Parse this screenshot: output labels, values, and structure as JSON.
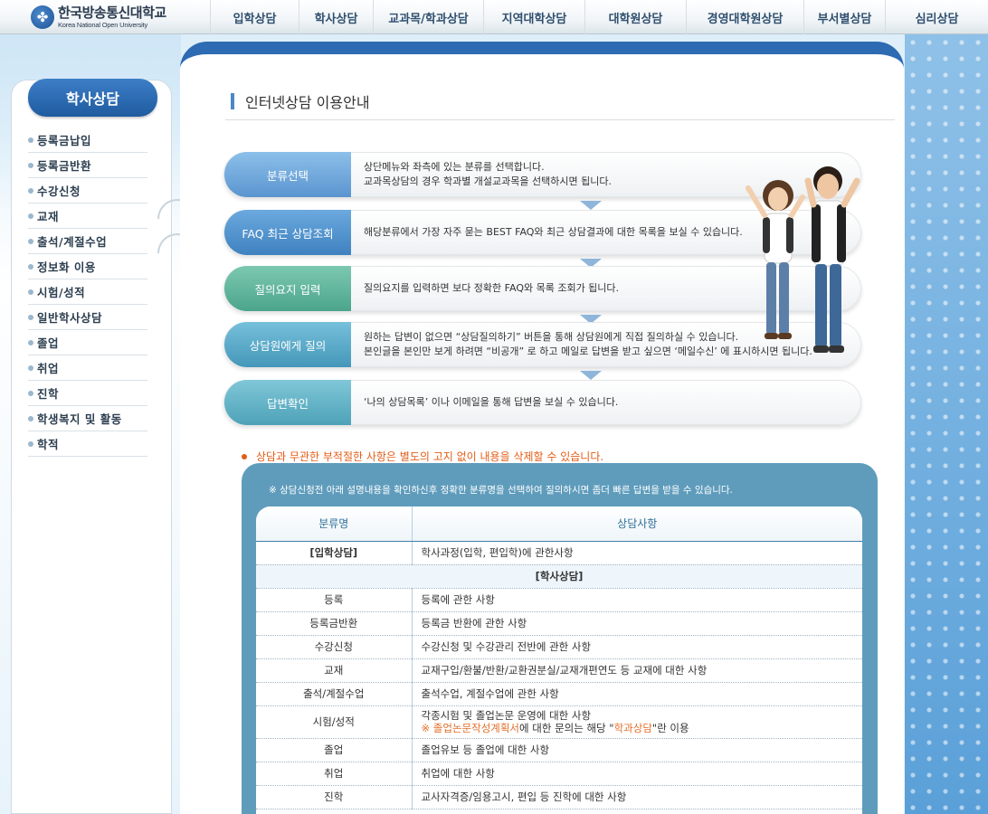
{
  "logo": {
    "mark": "✤",
    "name_ko": "한국방송통신대학교",
    "name_en": "Korea National Open University"
  },
  "nav": [
    {
      "label": "입학상담"
    },
    {
      "label": "학사상담"
    },
    {
      "label": "교과목/학과상담"
    },
    {
      "label": "지역대학상담"
    },
    {
      "label": "대학원상담"
    },
    {
      "label": "경영대학원상담"
    },
    {
      "label": "부서별상담"
    },
    {
      "label": "심리상담"
    }
  ],
  "sidebar": {
    "title": "학사상담",
    "items": [
      {
        "label": "등록금납입"
      },
      {
        "label": "등록금반환"
      },
      {
        "label": "수강신청"
      },
      {
        "label": "교재"
      },
      {
        "label": "출석/계절수업"
      },
      {
        "label": "정보화 이용"
      },
      {
        "label": "시험/성적"
      },
      {
        "label": "일반학사상담"
      },
      {
        "label": "졸업"
      },
      {
        "label": "취업"
      },
      {
        "label": "진학"
      },
      {
        "label": "학생복지 및 활동"
      },
      {
        "label": "학적"
      }
    ]
  },
  "main": {
    "title": "인터넷상담 이용안내",
    "steps": [
      {
        "label": "분류선택",
        "color": "#6aa3d7",
        "line1": "상단메뉴와 좌측에 있는 분류를 선택합니다.",
        "line2": "교과목상담의 경우 학과별 개설교과목을 선택하시면 됩니다."
      },
      {
        "label": "FAQ 최근 상담조회",
        "color": "#4a8fc9",
        "line1": "해당분류에서 가장 자주 묻는 BEST FAQ와 최근 상담결과에 대한 목록을 보실 수 있습니다.",
        "line2": ""
      },
      {
        "label": "질의요지 입력",
        "color": "#5bb09a",
        "line1": "질의요지를 입력하면 보다 정확한 FAQ와 목록 조회가 됩니다.",
        "line2": ""
      },
      {
        "label": "상담원에게 질의",
        "color": "#54a6c5",
        "line1": "원하는 답변이 없으면 “상담질의하기” 버튼을 통해 상담원에게 직접 질의하실 수 있습니다.",
        "line2": "본인글을 본인만 보게 하려면 “비공개” 로 하고 메일로 답변을 받고 싶으면 ‘메일수신’ 에 표시하시면 됩니다."
      },
      {
        "label": "답변확인",
        "color": "#5fb1c4",
        "line1": "‘나의 상담목록’ 이나 이메일을 통해 답변을 보실 수 있습니다.",
        "line2": ""
      }
    ],
    "notice": "상담과 무관한 부적절한 사항은 별도의 고지 없이 내용을 삭제할 수 있습니다.",
    "table_note": "※ 상담신청전 아래 설명내용을 확인하신후 정확한 분류명을 선택하여 질의하시면 좀더 빠른 답변을 받을 수 있습니다.",
    "table": {
      "headers": [
        "분류명",
        "상담사항"
      ],
      "row_admission": {
        "category": "[입학상담]",
        "desc": "학사과정(입학, 편입학)에 관한사항"
      },
      "section_label": "[학사상담]",
      "rows": [
        {
          "category": "등록",
          "desc": "등록에 관한 사항"
        },
        {
          "category": "등록금반환",
          "desc": "등록금 반환에 관한 사항"
        },
        {
          "category": "수강신청",
          "desc": "수강신청 및 수강관리 전반에 관한 사항"
        },
        {
          "category": "교재",
          "desc": "교재구입/환불/반환/교환권분실/교재개편연도 등 교재에 대한 사항"
        },
        {
          "category": "출석/계절수업",
          "desc": "출석수업, 계절수업에 관한 사항"
        }
      ],
      "exam_row": {
        "category": "시험/성적",
        "line1": "각종시험 및 졸업논문 운영에 대한 사항",
        "note_prefix": "※ 졸업논문작성계획서",
        "note_mid": "에 대한 문의는 해당 \"",
        "note_link": "학과상담",
        "note_suffix": "\"란 이용"
      },
      "rows2": [
        {
          "category": "졸업",
          "desc": "졸업유보 등 졸업에 대한 사항"
        },
        {
          "category": "취업",
          "desc": "취업에 대한 사항"
        },
        {
          "category": "진학",
          "desc": "교사자격증/임용고시, 편입 등 진학에 대한 사항"
        }
      ]
    }
  }
}
